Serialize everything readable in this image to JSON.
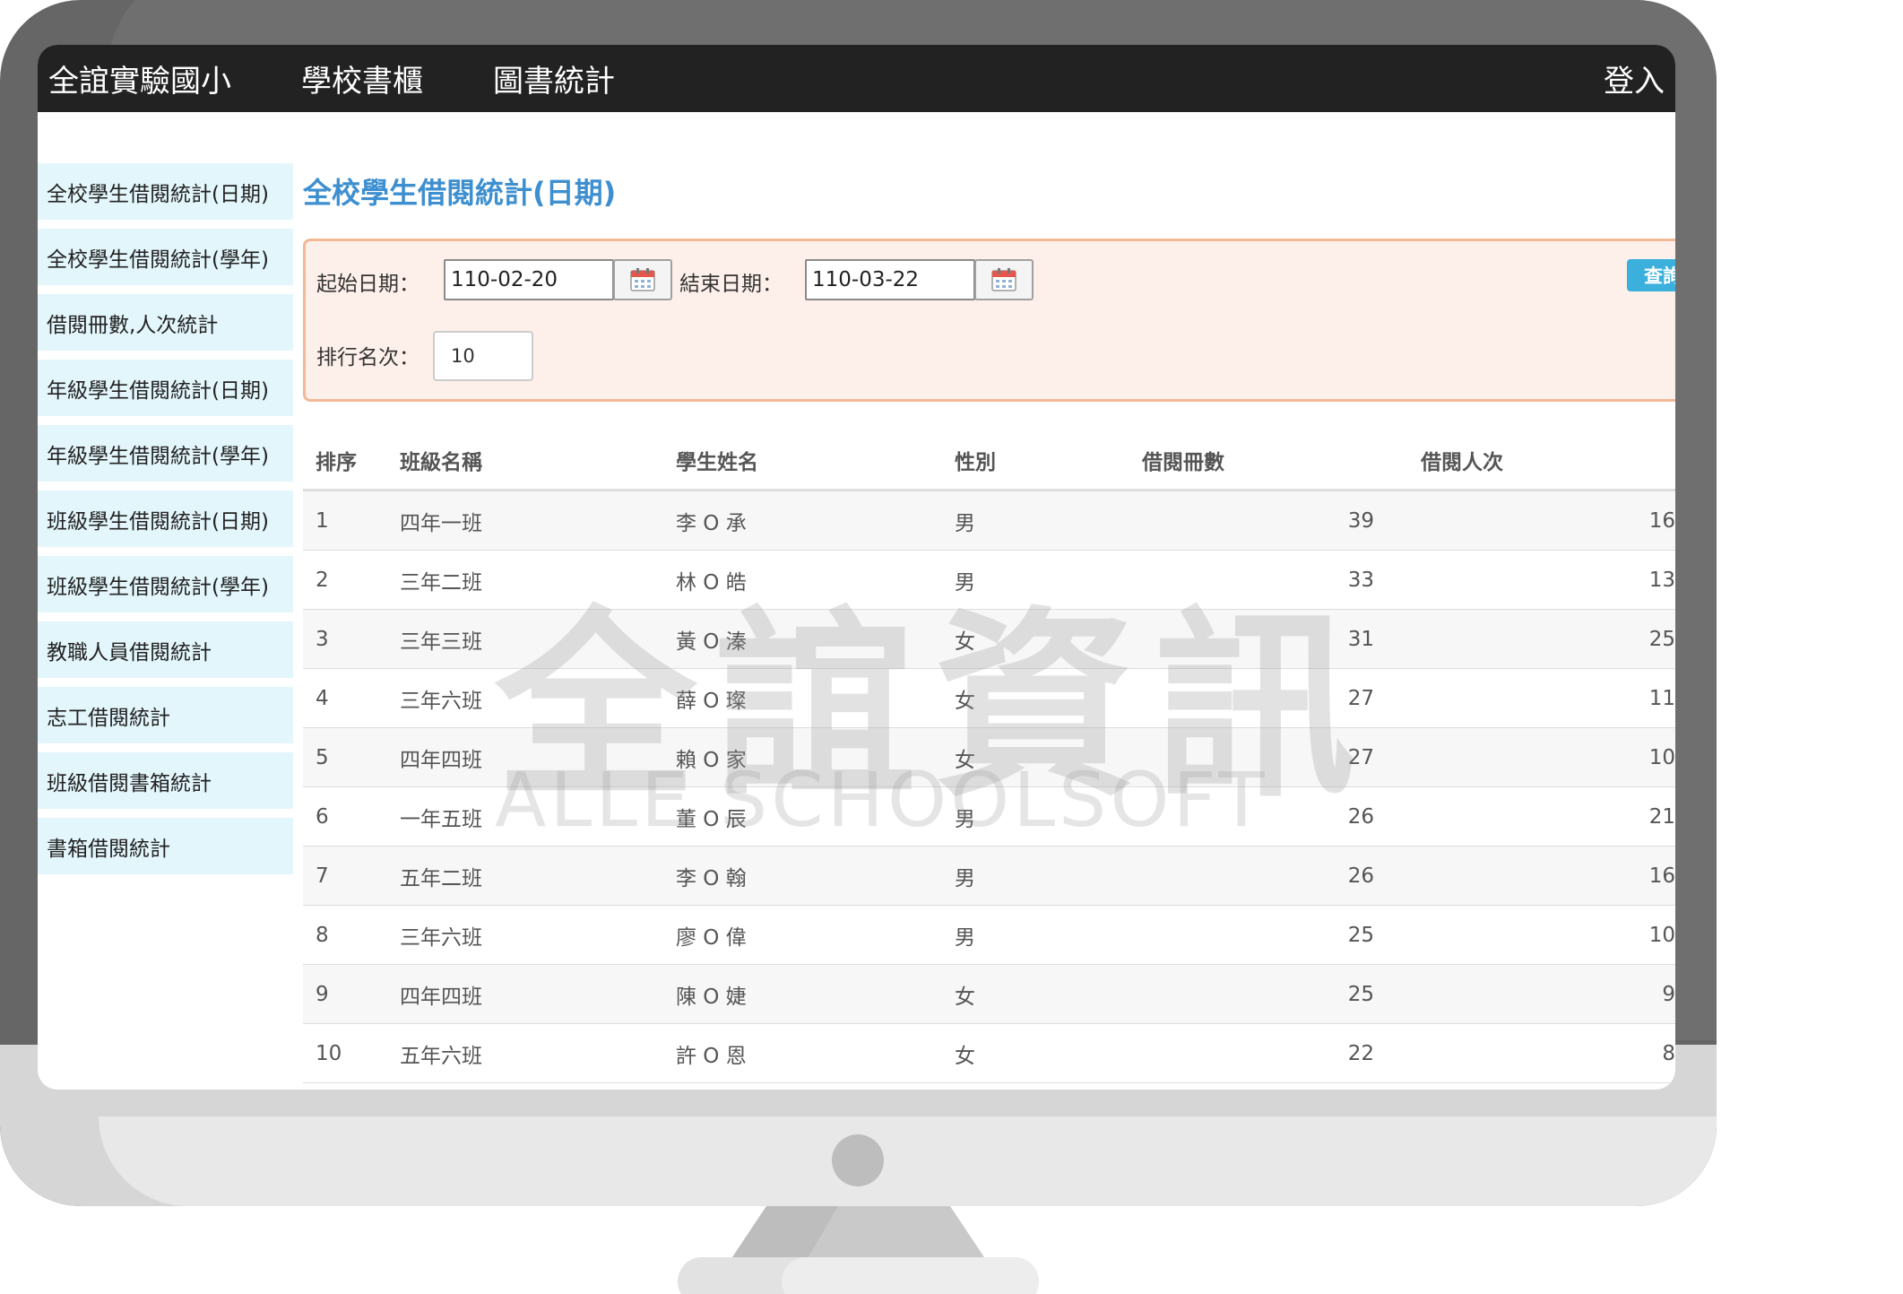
{
  "navbar": {
    "brand": "全誼實驗國小",
    "links": [
      "學校書櫃",
      "圖書統計"
    ],
    "login": "登入"
  },
  "sidebar": {
    "items": [
      "全校學生借閱統計(日期)",
      "全校學生借閱統計(學年)",
      "借閱冊數,人次統計",
      "年級學生借閱統計(日期)",
      "年級學生借閱統計(學年)",
      "班級學生借閱統計(日期)",
      "班級學生借閱統計(學年)",
      "教職人員借閱統計",
      "志工借閱統計",
      "班級借閱書箱統計",
      "書箱借閱統計"
    ]
  },
  "page": {
    "title": "全校學生借閱統計(日期)"
  },
  "query": {
    "start_label": "起始日期：",
    "start_value": "110-02-20",
    "end_label": "結束日期：",
    "end_value": "110-03-22",
    "rank_label": "排行名次：",
    "rank_value": "10",
    "submit": "查詢"
  },
  "table": {
    "headers": [
      "排序",
      "班級名稱",
      "學生姓名",
      "性別",
      "借閱冊數",
      "借閱人次"
    ],
    "rows": [
      [
        "1",
        "四年一班",
        "李 O 承",
        "男",
        "39",
        "16"
      ],
      [
        "2",
        "三年二班",
        "林 O 皓",
        "男",
        "33",
        "13"
      ],
      [
        "3",
        "三年三班",
        "黃 O 溱",
        "女",
        "31",
        "25"
      ],
      [
        "4",
        "三年六班",
        "薛 O 璨",
        "女",
        "27",
        "11"
      ],
      [
        "5",
        "四年四班",
        "賴 O 家",
        "女",
        "27",
        "10"
      ],
      [
        "6",
        "一年五班",
        "董 O 辰",
        "男",
        "26",
        "21"
      ],
      [
        "7",
        "五年二班",
        "李 O 翰",
        "男",
        "26",
        "16"
      ],
      [
        "8",
        "三年六班",
        "廖 O 偉",
        "男",
        "25",
        "10"
      ],
      [
        "9",
        "四年四班",
        "陳 O 婕",
        "女",
        "25",
        "9"
      ],
      [
        "10",
        "五年六班",
        "許 O 恩",
        "女",
        "22",
        "8"
      ]
    ]
  },
  "watermark": {
    "cn": "全誼資訊",
    "en": "ALLE SCHOOLSOFT"
  },
  "colors": {
    "accent": "#3d8fd0",
    "button": "#3bb0dc",
    "navbar": "#222222",
    "sidebar": "#e3f6fc",
    "panel": "#fdf0ea"
  }
}
